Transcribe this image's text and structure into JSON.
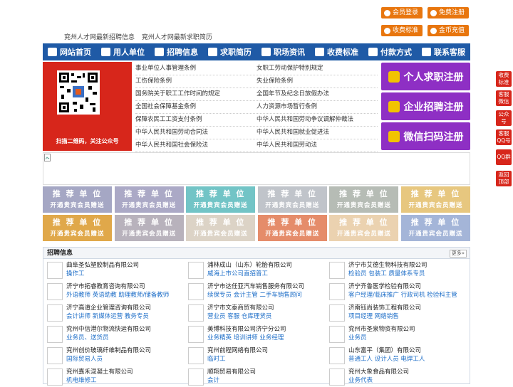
{
  "top_buttons": {
    "login": "会员登录",
    "register": "免费注册",
    "fees": "收费标准",
    "recharge": "金币充值"
  },
  "top_links": [
    "兖州人才网最新招聘信息",
    "兖州人才网最新求职简历"
  ],
  "nav": [
    {
      "label": "网站首页",
      "icon": "home-icon"
    },
    {
      "label": "用人单位",
      "icon": "building-icon"
    },
    {
      "label": "招聘信息",
      "icon": "people-icon"
    },
    {
      "label": "求职简历",
      "icon": "resume-icon"
    },
    {
      "label": "职场资讯",
      "icon": "news-icon"
    },
    {
      "label": "收费标准",
      "icon": "fee-icon"
    },
    {
      "label": "付款方式",
      "icon": "payment-icon"
    },
    {
      "label": "联系客服",
      "icon": "phone-icon"
    }
  ],
  "qr_caption": "扫描二维码，关注公众号",
  "laws": [
    [
      "事业单位人事管理条例",
      "女职工劳动保护特别规定"
    ],
    [
      "工伤保险条例",
      "失业保险条例"
    ],
    [
      "国务院关于职工工作时间的规定",
      "全国年节及纪念日放假办法"
    ],
    [
      "全国社会保障基金条例",
      "人力资源市场暂行条例"
    ],
    [
      "保障农民工工资支付条例",
      "中华人民共和国劳动争议调解仲裁法"
    ],
    [
      "中华人民共和国劳动合同法",
      "中华人民共和国就业促进法"
    ],
    [
      "中华人民共和国社会保险法",
      "中华人民共和国劳动法"
    ]
  ],
  "register_buttons": [
    {
      "label": "个人求职注册",
      "icon": "person-icon"
    },
    {
      "label": "企业招聘注册",
      "icon": "company-icon"
    },
    {
      "label": "微信扫码注册",
      "icon": "wechat-icon"
    }
  ],
  "recommend": {
    "title": "推 荐 单 位",
    "subtitle": "开通贵宾会员赠送",
    "colors": [
      "#a5a7c4",
      "#aba9c6",
      "#72c4c6",
      "#c0c4ca",
      "#b6bcb5",
      "#e7c77f",
      "#e0a84a",
      "#b8b2bc",
      "#dcd3c6",
      "#e58c6a",
      "#ebd2b0",
      "#a4b5d8"
    ]
  },
  "jobs": {
    "header": "招聘信息",
    "more": "更多»",
    "items": [
      {
        "company": "曲阜圣弘塑胶制品有限公司",
        "positions": "操作工"
      },
      {
        "company": "浦林成山（山东）轮胎有限公司",
        "positions": "威海上市公司直招普工"
      },
      {
        "company": "济宁市艾德生物科技有限公司",
        "positions": "检验员 包装工 质量体系专员"
      },
      {
        "company": "济宁市拓睿教育咨询有限公司",
        "positions": "外语教师 英语助教 助理教师/储备教师"
      },
      {
        "company": "济宁市达任亚汽车销售服务有限公司",
        "positions": "续保专员 会计主管 二手车销售顾问"
      },
      {
        "company": "济宁齐鲁医学检验有限公司",
        "positions": "客户经理/临床推广 行政司机 检验科主管"
      },
      {
        "company": "济宁高道企业管理咨询有限公司",
        "positions": "会计讲师 新媒体运营 教务专员"
      },
      {
        "company": "济宁市文泰商贸有限公司",
        "positions": "营业员 客服 仓库理货员"
      },
      {
        "company": "济南钰尚装饰工程有限公司",
        "positions": "项目经理 网络销售"
      },
      {
        "company": "兖州中信港尔物流快运有限公司",
        "positions": "业务员、送货员"
      },
      {
        "company": "美博科技有限公司济宁分公司",
        "positions": "业务精英 培训讲师 业务经理"
      },
      {
        "company": "兖州市圣泉物资有限公司",
        "positions": "业务员"
      },
      {
        "company": "兖州创价玻璃纤维制品有限公司",
        "positions": "国际贸易人员"
      },
      {
        "company": "兖州前程网络有限公司",
        "positions": "临时工"
      },
      {
        "company": "山东富平（集团）有限公司",
        "positions": "普通工人 设计人员 电焊工人"
      },
      {
        "company": "兖州嘉禾混凝土有限公司",
        "positions": "机电维修工"
      },
      {
        "company": "顺翔贸易有限公司",
        "positions": "会计"
      },
      {
        "company": "兖州大象食品有限公司",
        "positions": "业务代表"
      }
    ]
  },
  "side_buttons": [
    {
      "label": "收费标准"
    },
    {
      "label": "客服微信"
    },
    {
      "label": "公众号"
    },
    {
      "label": "客服QQ号"
    },
    {
      "label": "QQ群"
    },
    {
      "label": "返回顶部"
    }
  ]
}
